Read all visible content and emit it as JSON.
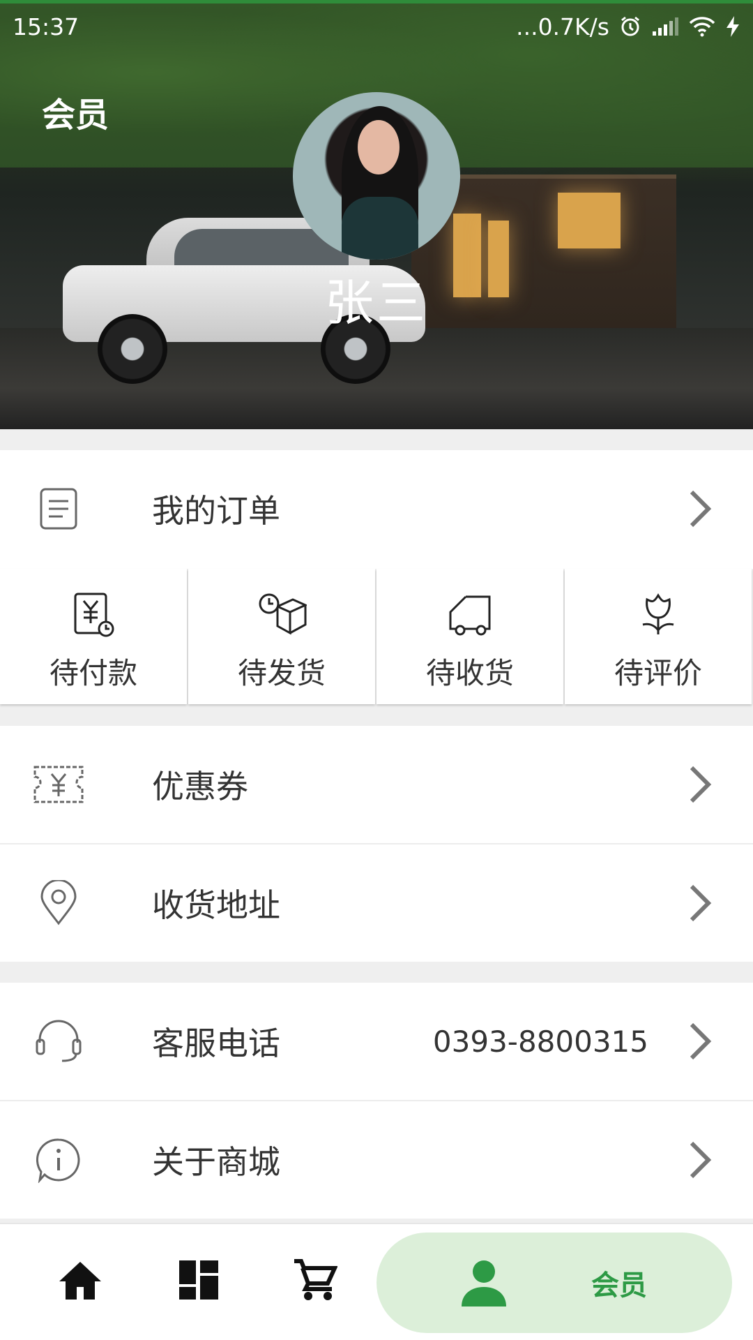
{
  "status_bar": {
    "time": "15:37",
    "network_speed": "...0.7K/s",
    "icons": [
      "alarm-icon",
      "signal-icon",
      "wifi-icon",
      "charging-icon"
    ]
  },
  "header": {
    "title": "会员",
    "username": "张三"
  },
  "orders": {
    "label": "我的订单",
    "tabs": [
      {
        "label": "待付款",
        "icon": "pending-payment-icon"
      },
      {
        "label": "待发货",
        "icon": "pending-shipment-icon"
      },
      {
        "label": "待收货",
        "icon": "pending-receipt-icon"
      },
      {
        "label": "待评价",
        "icon": "pending-review-icon"
      }
    ]
  },
  "menu": {
    "coupons": {
      "label": "优惠券",
      "icon": "coupon-icon"
    },
    "address": {
      "label": "收货地址",
      "icon": "location-icon"
    },
    "service": {
      "label": "客服电话",
      "value": "0393-8800315",
      "icon": "headset-icon"
    },
    "about": {
      "label": "关于商城",
      "icon": "info-icon"
    }
  },
  "bottom_nav": {
    "items": [
      {
        "icon": "home-icon"
      },
      {
        "icon": "category-icon"
      },
      {
        "icon": "cart-icon"
      },
      {
        "icon": "member-icon",
        "label": "会员",
        "active": true
      }
    ]
  },
  "colors": {
    "accent": "#2d9a45",
    "active_nav_bg": "#dcefd9",
    "status_top_line": "#22b14c"
  }
}
